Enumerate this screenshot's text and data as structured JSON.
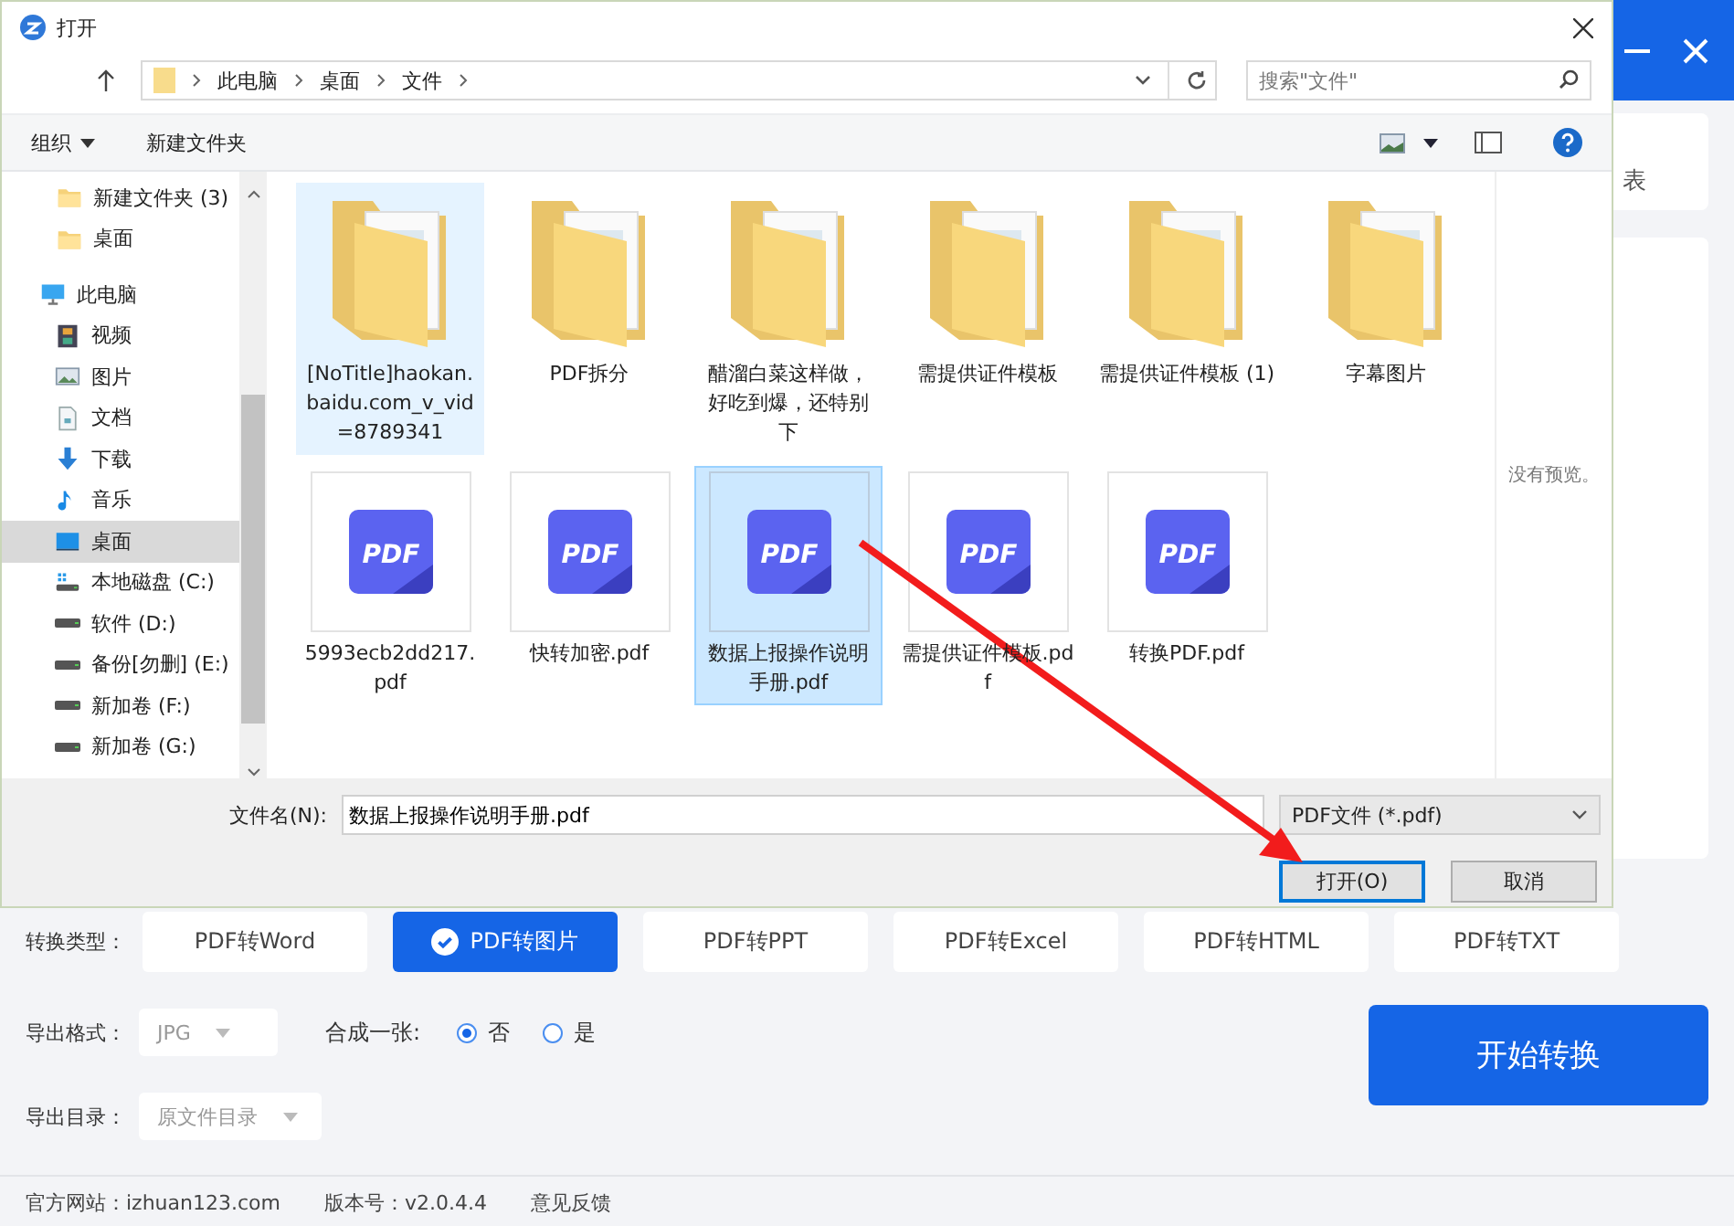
{
  "app": {
    "partial_label": "表",
    "conversion": {
      "label": "转换类型：",
      "types": [
        {
          "label": "PDF转Word",
          "selected": false
        },
        {
          "label": "PDF转图片",
          "selected": true
        },
        {
          "label": "PDF转PPT",
          "selected": false
        },
        {
          "label": "PDF转Excel",
          "selected": false
        },
        {
          "label": "PDF转HTML",
          "selected": false
        },
        {
          "label": "PDF转TXT",
          "selected": false
        }
      ]
    },
    "format": {
      "label": "导出格式：",
      "value": "JPG"
    },
    "merge": {
      "label": "合成一张:",
      "options": [
        {
          "label": "否",
          "selected": true
        },
        {
          "label": "是",
          "selected": false
        }
      ]
    },
    "output_dir": {
      "label": "导出目录：",
      "value": "原文件目录"
    },
    "start_button": "开始转换",
    "footer": [
      "官方网站：izhuan123.com",
      "版本号：v2.0.4.4",
      "意见反馈"
    ]
  },
  "dialog": {
    "title": "打开",
    "breadcrumbs": [
      "此电脑",
      "桌面",
      "文件"
    ],
    "search": {
      "placeholder": "搜索\"文件\""
    },
    "toolbar": {
      "organize": "组织",
      "new_folder": "新建文件夹"
    },
    "sidebar": {
      "quick_items": [
        {
          "label": "新建文件夹 (3)",
          "selected": false
        },
        {
          "label": "桌面",
          "selected": false
        }
      ],
      "tree": [
        {
          "label": "此电脑",
          "selected": false,
          "children": [
            {
              "label": "视频",
              "selected": false
            },
            {
              "label": "图片",
              "selected": false
            },
            {
              "label": "文档",
              "selected": false
            },
            {
              "label": "下载",
              "selected": false
            },
            {
              "label": "音乐",
              "selected": false
            },
            {
              "label": "桌面",
              "selected": true
            },
            {
              "label": "本地磁盘 (C:)",
              "selected": false
            },
            {
              "label": "软件 (D:)",
              "selected": false
            },
            {
              "label": "备份[勿删] (E:)",
              "selected": false
            },
            {
              "label": "新加卷 (F:)",
              "selected": false
            },
            {
              "label": "新加卷 (G:)",
              "selected": false
            }
          ]
        }
      ]
    },
    "files": [
      {
        "name": "[NoTitle]haokan.baidu.com_v_vid=8789341",
        "kind": "folder",
        "selected": false,
        "hovered": true
      },
      {
        "name": "PDF拆分",
        "kind": "folder",
        "selected": false,
        "hovered": false
      },
      {
        "name": "醋溜白菜这样做，好吃到爆，还特别下",
        "kind": "folder",
        "selected": false,
        "hovered": false
      },
      {
        "name": "需提供证件模板",
        "kind": "folder",
        "selected": false,
        "hovered": false
      },
      {
        "name": "需提供证件模板 (1)",
        "kind": "folder",
        "selected": false,
        "hovered": false
      },
      {
        "name": "字幕图片",
        "kind": "folder",
        "selected": false,
        "hovered": false
      },
      {
        "name": "5993ecb2dd217.pdf",
        "kind": "pdf",
        "icon_text": "PDF",
        "selected": false,
        "hovered": false
      },
      {
        "name": "快转加密.pdf",
        "kind": "pdf",
        "icon_text": "PDF",
        "selected": false,
        "hovered": false
      },
      {
        "name": "数据上报操作说明手册.pdf",
        "kind": "pdf",
        "icon_text": "PDF",
        "selected": true,
        "hovered": false
      },
      {
        "name": "需提供证件模板.pdf",
        "kind": "pdf",
        "icon_text": "PDF",
        "selected": false,
        "hovered": false
      },
      {
        "name": "转换PDF.pdf",
        "kind": "pdf",
        "icon_text": "PDF",
        "selected": false,
        "hovered": false
      }
    ],
    "preview": "没有预览。",
    "filename": {
      "label": "文件名(N):",
      "value": "数据上报操作说明手册.pdf"
    },
    "filetype": "PDF文件 (*.pdf)",
    "buttons": [
      {
        "label": "打开(O)",
        "default": true
      },
      {
        "label": "取消",
        "default": false
      }
    ]
  }
}
